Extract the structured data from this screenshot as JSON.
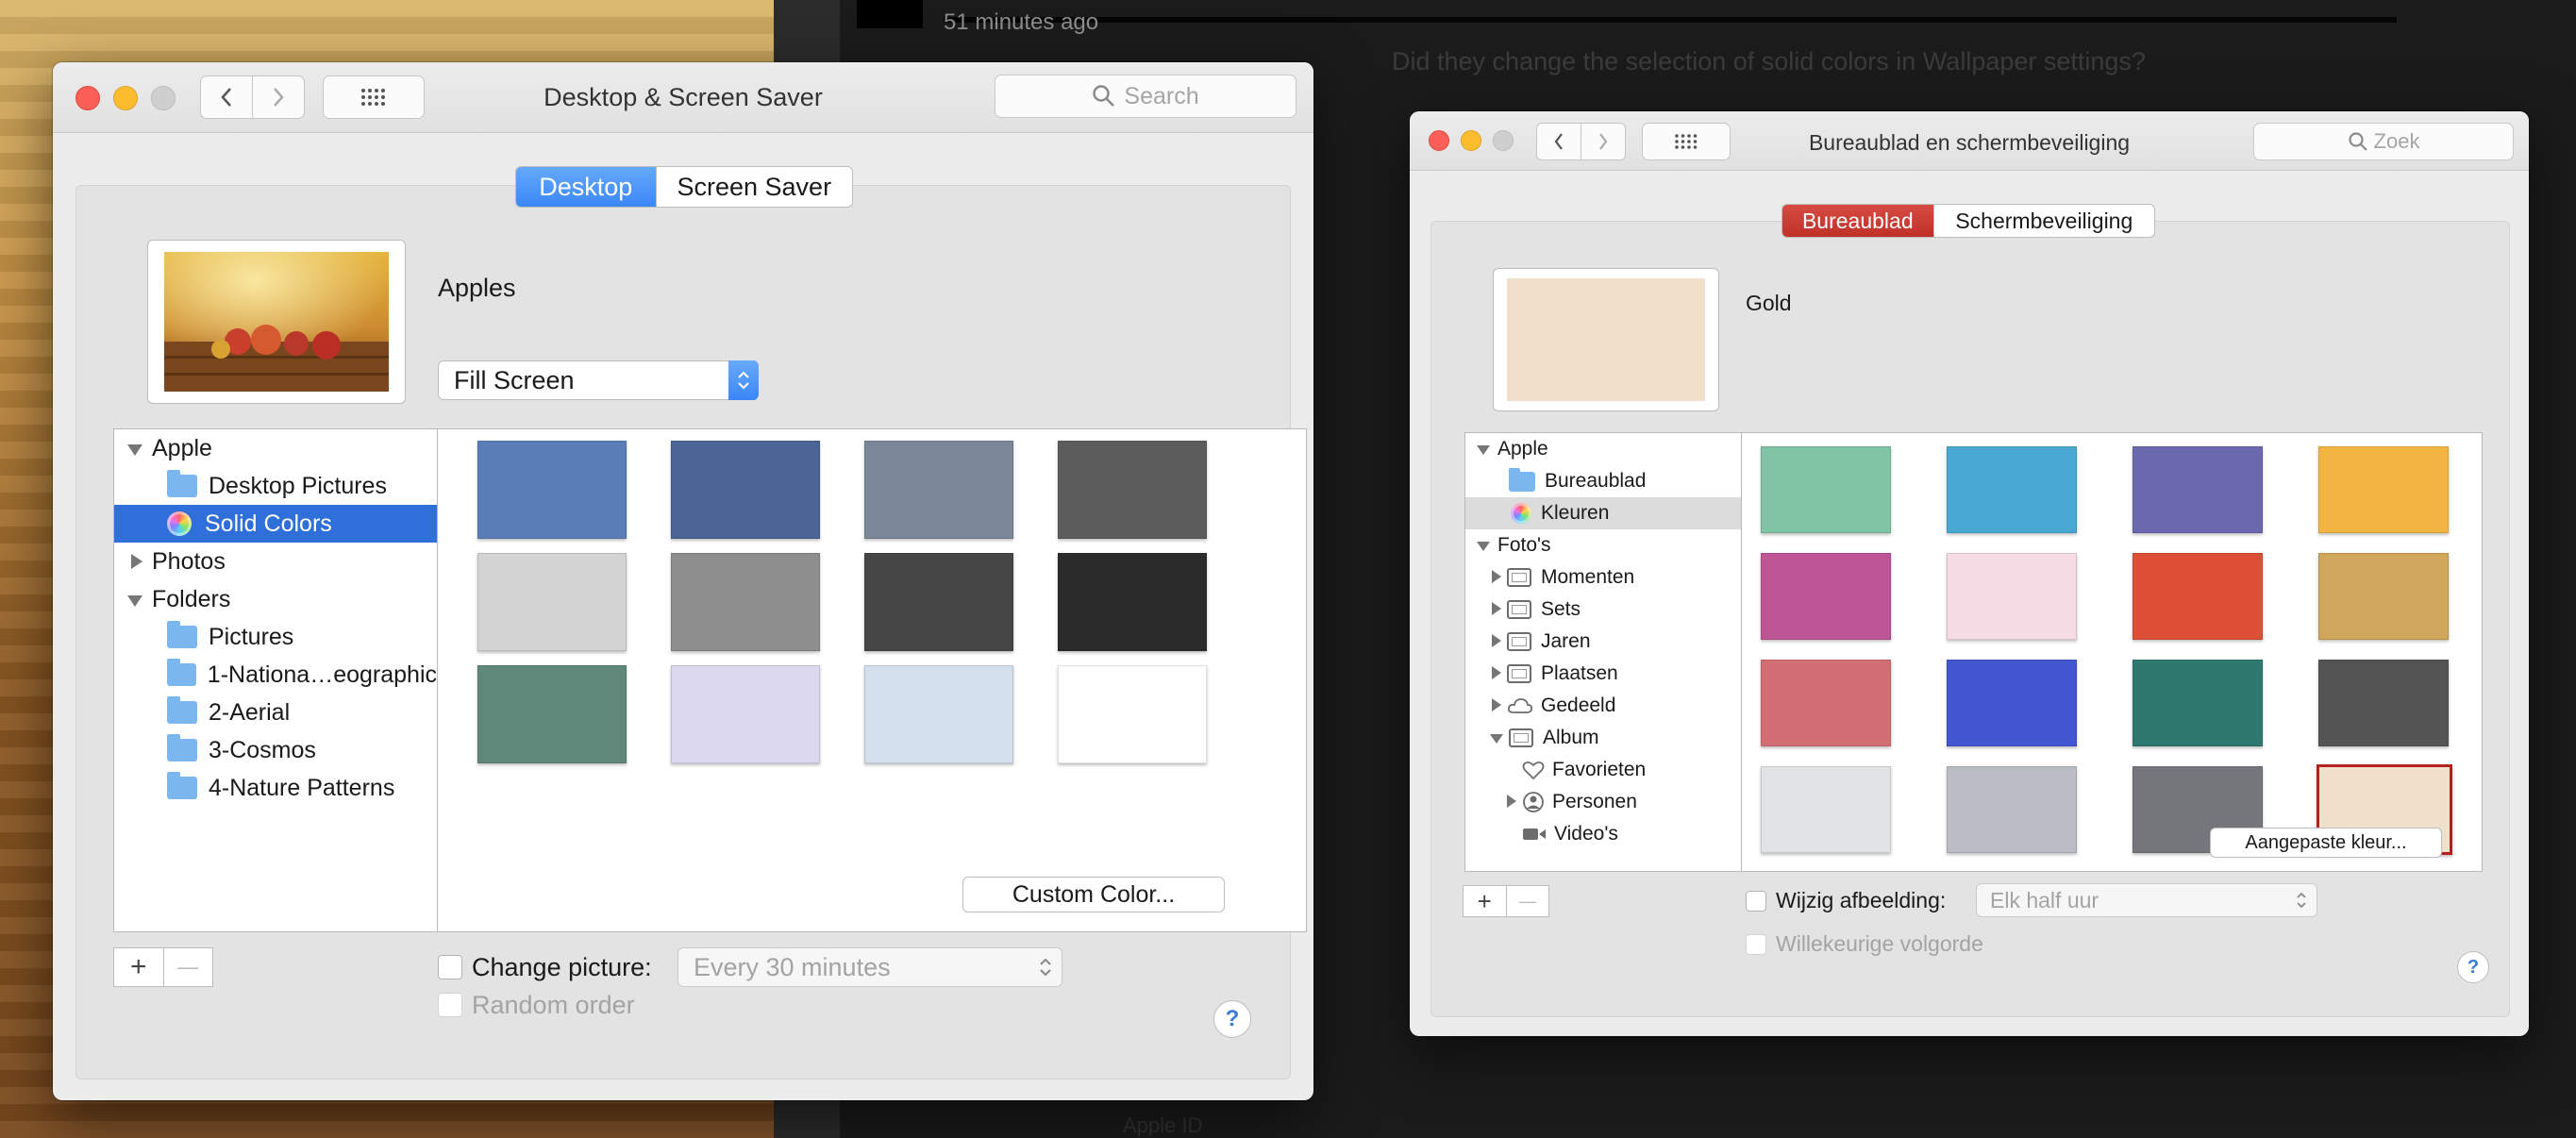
{
  "background": {
    "time_label": "51 minutes ago",
    "question_text": "Did they change the selection of solid colors in Wallpaper settings?",
    "bottom_text": "Apple ID"
  },
  "window_en": {
    "title": "Desktop & Screen Saver",
    "search_placeholder": "Search",
    "tabs": [
      "Desktop",
      "Screen Saver"
    ],
    "active_tab": "Desktop",
    "preview_name": "Apples",
    "fill_mode": "Fill Screen",
    "sidebar": {
      "apple": "Apple",
      "desktop_pictures": "Desktop Pictures",
      "solid_colors": "Solid Colors",
      "photos": "Photos",
      "folders": "Folders",
      "folder_items": [
        "Pictures",
        "1-Nationa…eographic",
        "2-Aerial",
        "3-Cosmos",
        "4-Nature Patterns"
      ]
    },
    "swatches": [
      "#5a7db8",
      "#4a6596",
      "#7a8799",
      "#5c5c5c",
      "#d3d3d3",
      "#8e8e8e",
      "#464646",
      "#2b2b2b",
      "#5f877a",
      "#dcd8ee",
      "#d3dfec",
      "#ffffff"
    ],
    "custom_color_button": "Custom Color...",
    "change_picture_label": "Change picture:",
    "change_interval": "Every 30 minutes",
    "random_order_label": "Random order",
    "plus": "+",
    "minus": "—",
    "help": "?"
  },
  "window_nl": {
    "title": "Bureaublad en schermbeveiliging",
    "search_placeholder": "Zoek",
    "tabs": [
      "Bureaublad",
      "Schermbeveiliging"
    ],
    "active_tab": "Bureaublad",
    "preview_name": "Gold",
    "preview_color": "#f0dfca",
    "sidebar": {
      "apple": "Apple",
      "bureaublad": "Bureaublad",
      "kleuren": "Kleuren",
      "fotos": "Foto's",
      "photo_items": [
        "Momenten",
        "Sets",
        "Jaren",
        "Plaatsen",
        "Gedeeld",
        "Album"
      ],
      "album_items": [
        "Favorieten",
        "Personen",
        "Video's"
      ]
    },
    "swatches": [
      "#80c3a5",
      "#49a8d1",
      "#6a68af",
      "#f2b542",
      "#bd5596",
      "#f5dbe3",
      "#dd4f37",
      "#cfa65c",
      "#d46e75",
      "#4256cf",
      "#2e786f",
      "#545454",
      "#e2e3e5",
      "#b9bcc2",
      "#75767b",
      "#f0dfca"
    ],
    "custom_color_button": "Aangepaste kleur...",
    "change_picture_label": "Wijzig afbeelding:",
    "change_interval": "Elk half uur",
    "random_order_label": "Willekeurige volgorde",
    "plus": "+",
    "minus": "—",
    "help": "?"
  }
}
